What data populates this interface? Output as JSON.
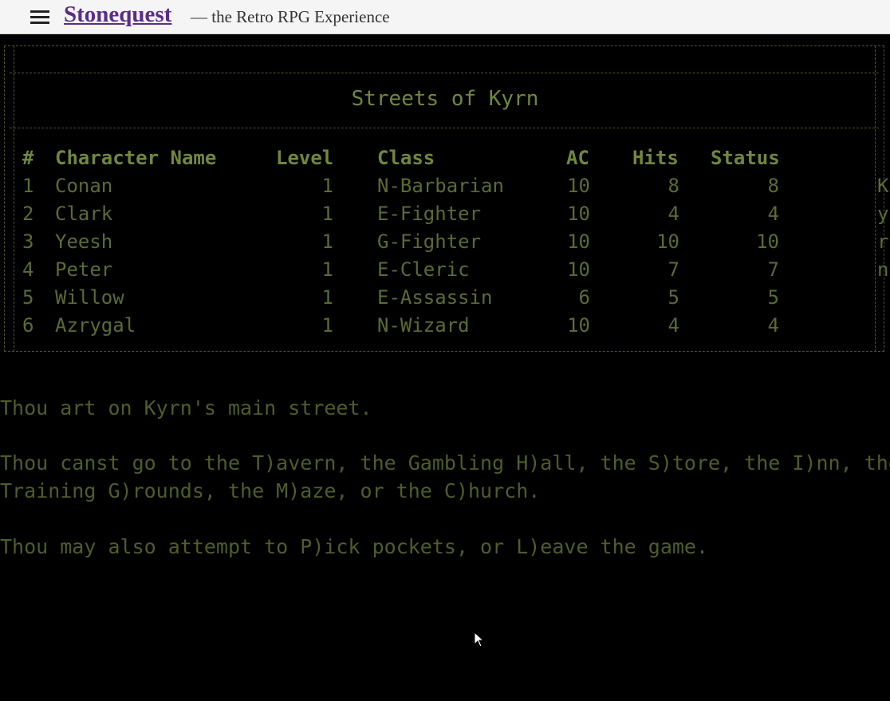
{
  "header": {
    "menu_icon": "hamburger-icon",
    "title": "Stonequest",
    "subtitle": "— the Retro RPG Experience"
  },
  "game": {
    "location_title": "Streets of Kyrn",
    "columns": [
      "#",
      "Character Name",
      "Level",
      "Class",
      "AC",
      "Hits",
      "Status"
    ],
    "party": [
      {
        "num": "1",
        "name": "Conan",
        "level": "1",
        "class": "N-Barbarian",
        "ac": "10",
        "hits": "8",
        "status": "8",
        "extra": "K"
      },
      {
        "num": "2",
        "name": "Clark",
        "level": "1",
        "class": "E-Fighter",
        "ac": "10",
        "hits": "4",
        "status": "4",
        "extra": "y"
      },
      {
        "num": "3",
        "name": "Yeesh",
        "level": "1",
        "class": "G-Fighter",
        "ac": "10",
        "hits": "10",
        "status": "10",
        "extra": "r"
      },
      {
        "num": "4",
        "name": "Peter",
        "level": "1",
        "class": "E-Cleric",
        "ac": "10",
        "hits": "7",
        "status": "7",
        "extra": "n"
      },
      {
        "num": "5",
        "name": "Willow",
        "level": "1",
        "class": "E-Assassin",
        "ac": "6",
        "hits": "5",
        "status": "5",
        "extra": ""
      },
      {
        "num": "6",
        "name": "Azrygal",
        "level": "1",
        "class": "N-Wizard",
        "ac": "10",
        "hits": "4",
        "status": "4",
        "extra": ""
      }
    ],
    "messages": [
      "Thou art on Kyrn's main street.",
      "Thou canst go to the T)avern, the Gambling H)all, the S)tore, the I)nn, the",
      "Training G)rounds, the M)aze, or the C)hurch.",
      "Thou may also attempt to P)ick pockets, or L)eave the game."
    ]
  },
  "colors": {
    "terminal_bg": "#000000",
    "terminal_text": "#5b6b33",
    "title_link": "#5b2c8a"
  }
}
